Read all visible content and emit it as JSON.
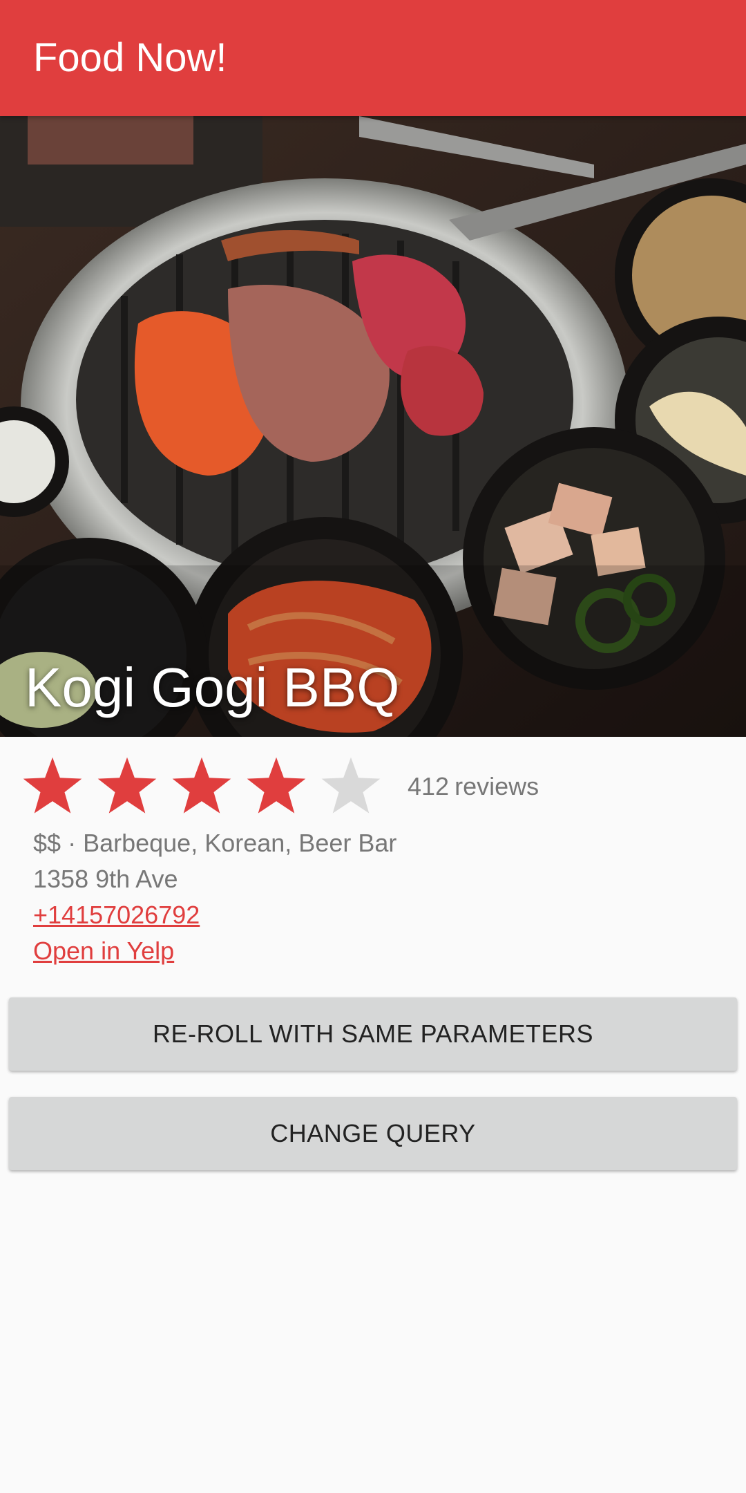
{
  "app": {
    "title": "Food Now!"
  },
  "restaurant": {
    "name": "Kogi Gogi BBQ",
    "rating": 4,
    "max_rating": 5,
    "review_count": "412",
    "review_label": "reviews",
    "price": "$$",
    "separator": "·",
    "categories": "Barbeque, Korean, Beer Bar",
    "address": "1358 9th Ave",
    "phone": "+14157026792",
    "yelp_link": "Open in Yelp"
  },
  "actions": {
    "reroll_label": "RE-ROLL WITH SAME PARAMETERS",
    "change_query_label": "CHANGE QUERY"
  },
  "colors": {
    "accent": "#e03e3e",
    "star_filled": "#e03e3e",
    "star_empty": "#d9d9d9",
    "button_bg": "#d6d7d7"
  },
  "icons": {
    "star": "star-icon"
  }
}
